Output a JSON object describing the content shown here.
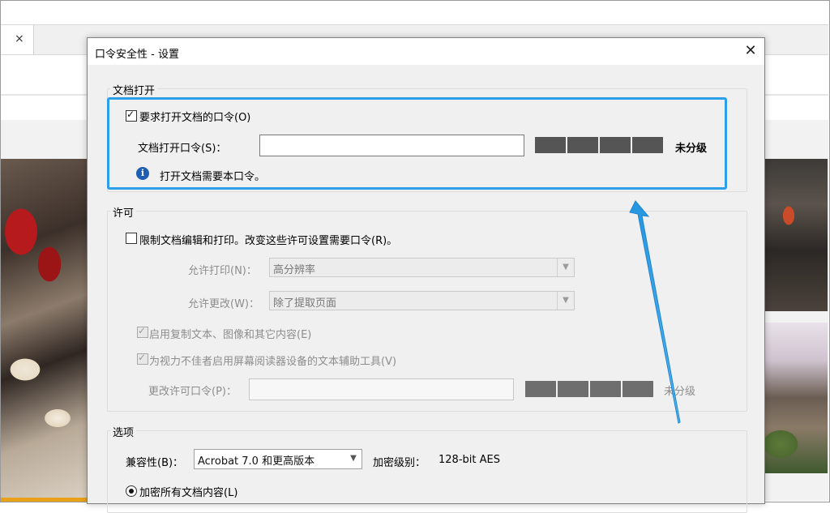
{
  "background_app": {
    "tab_close_glyph": "×"
  },
  "dialog": {
    "title": "口令安全性 - 设置",
    "close_glyph": "✕",
    "doc_open": {
      "group_label": "文档打开",
      "require_password_label": "要求打开文档的口令(O)",
      "require_password_checked": true,
      "password_label": "文档打开口令(S)：",
      "password_value": "",
      "strength_text": "未分级",
      "info_icon": "info-icon",
      "info_text": "打开文档需要本口令。"
    },
    "permissions": {
      "group_label": "许可",
      "restrict_label": "限制文档编辑和打印。改变这些许可设置需要口令(R)。",
      "restrict_checked": false,
      "printing_label": "允许打印(N)：",
      "printing_value": "高分辨率",
      "changes_label": "允许更改(W)：",
      "changes_value": "除了提取页面",
      "copy_label": "启用复制文本、图像和其它内容(E)",
      "copy_checked": true,
      "screenreader_label": "为视力不佳者启用屏幕阅读器设备的文本辅助工具(V)",
      "screenreader_checked": true,
      "perm_password_label": "更改许可口令(P)：",
      "perm_password_value": "",
      "strength_text": "未分级"
    },
    "options": {
      "group_label": "选项",
      "compat_label": "兼容性(B)：",
      "compat_value": "Acrobat 7.0 和更高版本",
      "enc_level_label": "加密级别：",
      "enc_level_value": "128-bit AES",
      "encrypt_all_label": "加密所有文档内容(L)",
      "encrypt_all_selected": true
    }
  },
  "annotation": {
    "highlight_color": "#2d9fe8"
  }
}
